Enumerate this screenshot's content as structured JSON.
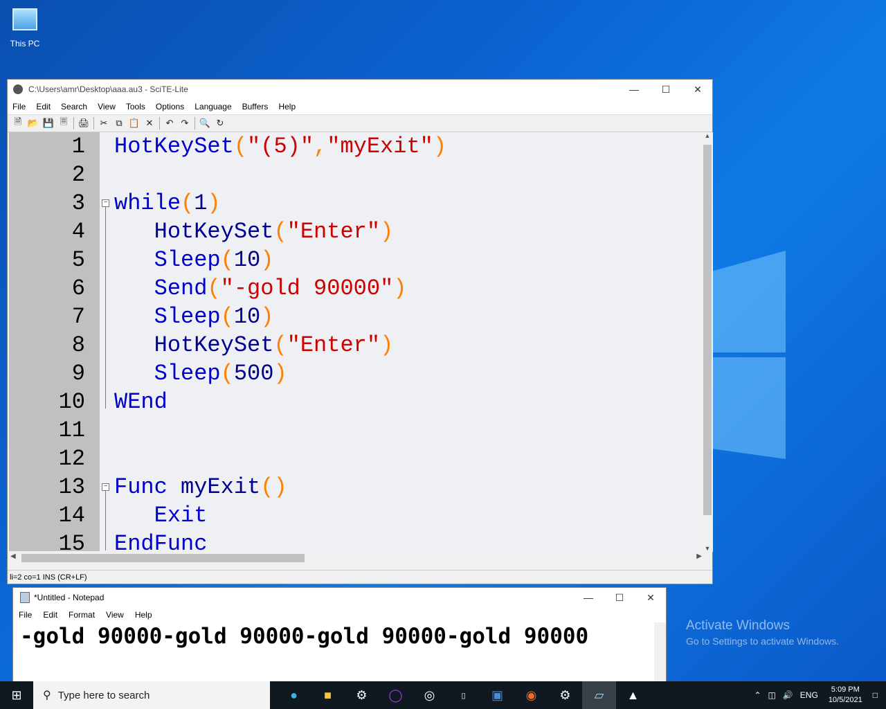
{
  "desktop": {
    "icons": [
      {
        "label": "This PC"
      }
    ],
    "activate": {
      "line1": "Activate Windows",
      "line2": "Go to Settings to activate Windows."
    }
  },
  "scite": {
    "title": "C:\\Users\\amr\\Desktop\\aaa.au3 - SciTE-Lite",
    "menu": [
      "File",
      "Edit",
      "Search",
      "View",
      "Tools",
      "Options",
      "Language",
      "Buffers",
      "Help"
    ],
    "toolbar_icons": [
      "new-icon",
      "open-icon",
      "save-icon",
      "close-file-icon",
      "print-icon",
      "cut-icon",
      "copy-icon",
      "paste-icon",
      "delete-icon",
      "undo-icon",
      "redo-icon",
      "find-icon",
      "replace-icon"
    ],
    "lines": [
      {
        "n": "1",
        "tokens": [
          {
            "t": "HotKeySet",
            "c": "kw"
          },
          {
            "t": "(",
            "c": "op"
          },
          {
            "t": "\"(5)\"",
            "c": "str"
          },
          {
            "t": ",",
            "c": "op"
          },
          {
            "t": "\"myExit\"",
            "c": "str"
          },
          {
            "t": ")",
            "c": "op"
          }
        ]
      },
      {
        "n": "2",
        "tokens": []
      },
      {
        "n": "3",
        "tokens": [
          {
            "t": "while",
            "c": "kw"
          },
          {
            "t": "(",
            "c": "op"
          },
          {
            "t": "1",
            "c": "num"
          },
          {
            "t": ")",
            "c": "op"
          }
        ]
      },
      {
        "n": "4",
        "tokens": [
          {
            "t": "   HotKeySet",
            "c": "fn"
          },
          {
            "t": "(",
            "c": "op"
          },
          {
            "t": "\"Enter\"",
            "c": "str"
          },
          {
            "t": ")",
            "c": "op"
          }
        ]
      },
      {
        "n": "5",
        "tokens": [
          {
            "t": "   Sleep",
            "c": "kw"
          },
          {
            "t": "(",
            "c": "op"
          },
          {
            "t": "10",
            "c": "num"
          },
          {
            "t": ")",
            "c": "op"
          }
        ]
      },
      {
        "n": "6",
        "tokens": [
          {
            "t": "   Send",
            "c": "kw"
          },
          {
            "t": "(",
            "c": "op"
          },
          {
            "t": "\"-gold 90000\"",
            "c": "str"
          },
          {
            "t": ")",
            "c": "op"
          }
        ]
      },
      {
        "n": "7",
        "tokens": [
          {
            "t": "   Sleep",
            "c": "kw"
          },
          {
            "t": "(",
            "c": "op"
          },
          {
            "t": "10",
            "c": "num"
          },
          {
            "t": ")",
            "c": "op"
          }
        ]
      },
      {
        "n": "8",
        "tokens": [
          {
            "t": "   HotKeySet",
            "c": "fn"
          },
          {
            "t": "(",
            "c": "op"
          },
          {
            "t": "\"Enter\"",
            "c": "str"
          },
          {
            "t": ")",
            "c": "op"
          }
        ]
      },
      {
        "n": "9",
        "tokens": [
          {
            "t": "   Sleep",
            "c": "kw"
          },
          {
            "t": "(",
            "c": "op"
          },
          {
            "t": "500",
            "c": "num"
          },
          {
            "t": ")",
            "c": "op"
          }
        ]
      },
      {
        "n": "10",
        "tokens": [
          {
            "t": "WEnd",
            "c": "kw"
          }
        ]
      },
      {
        "n": "11",
        "tokens": []
      },
      {
        "n": "12",
        "tokens": []
      },
      {
        "n": "13",
        "tokens": [
          {
            "t": "Func",
            "c": "kw"
          },
          {
            "t": " myExit",
            "c": "fn"
          },
          {
            "t": "()",
            "c": "op"
          }
        ]
      },
      {
        "n": "14",
        "tokens": [
          {
            "t": "   Exit",
            "c": "kw"
          }
        ]
      },
      {
        "n": "15",
        "tokens": [
          {
            "t": "EndFunc",
            "c": "kw"
          }
        ]
      }
    ],
    "status": "li=2 co=1 INS (CR+LF)"
  },
  "notepad": {
    "title": "*Untitled - Notepad",
    "menu": [
      "File",
      "Edit",
      "Format",
      "View",
      "Help"
    ],
    "text": "-gold 90000-gold 90000-gold 90000-gold 90000"
  },
  "taskbar": {
    "search_placeholder": "Type here to search",
    "apps": [
      "edge-icon",
      "file-explorer-icon",
      "steam-icon",
      "cortana-ring-icon",
      "ubisoft-icon",
      "epic-games-icon",
      "remote-desktop-icon",
      "origin-icon",
      "steam-icon",
      "scite-icon",
      "autoit-icon"
    ],
    "language": "ENG",
    "time": "5:09 PM",
    "date": "10/5/2021"
  }
}
